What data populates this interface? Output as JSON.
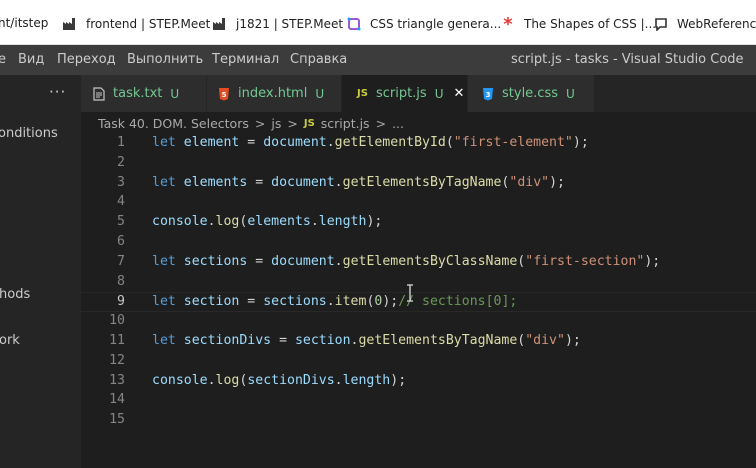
{
  "bookmarks": [
    {
      "label": "nt/itstep",
      "icon": "none"
    },
    {
      "label": "frontend | STEP.Meet",
      "icon": "factory-icon"
    },
    {
      "label": "j1821 | STEP.Meet",
      "icon": "factory-icon"
    },
    {
      "label": "CSS triangle genera...",
      "icon": "square-icon"
    },
    {
      "label": "The Shapes of CSS |...",
      "icon": "asterisk-icon"
    },
    {
      "label": "WebReference",
      "icon": "comment-icon"
    }
  ],
  "menu": [
    "е",
    "Вид",
    "Переход",
    "Выполнить",
    "Терминал",
    "Справка"
  ],
  "window_title": "script.js - tasks - Visual Studio Code",
  "sidebar": {
    "more": "···",
    "items": [
      "onditions",
      "hods",
      "ork"
    ]
  },
  "tabs": [
    {
      "label": "task.txt",
      "status": "U",
      "icon": "text-file-icon"
    },
    {
      "label": "index.html",
      "status": "U",
      "icon": "html5-icon"
    },
    {
      "label": "script.js",
      "status": "U",
      "icon": "js-icon",
      "active": true,
      "close": "✕"
    },
    {
      "label": "style.css",
      "status": "U",
      "icon": "css3-icon"
    }
  ],
  "breadcrumb": {
    "folder": "Task 40. DOM. Selectors",
    "sep1": ">",
    "sub": "js",
    "sep2": ">",
    "js_badge": "JS",
    "file": "script.js",
    "sep3": ">",
    "more": "..."
  },
  "editor": {
    "current_line": 9,
    "lines": [
      {
        "n": "1",
        "tokens": [
          [
            "kw",
            "let"
          ],
          [
            "punc",
            " "
          ],
          [
            "var",
            "element"
          ],
          [
            "punc",
            " = "
          ],
          [
            "var",
            "document"
          ],
          [
            "punc",
            "."
          ],
          [
            "fn",
            "getElementById"
          ],
          [
            "punc",
            "("
          ],
          [
            "str",
            "\"first-element\""
          ],
          [
            "punc",
            ");"
          ]
        ]
      },
      {
        "n": "2",
        "tokens": []
      },
      {
        "n": "3",
        "tokens": [
          [
            "kw",
            "let"
          ],
          [
            "punc",
            " "
          ],
          [
            "var",
            "elements"
          ],
          [
            "punc",
            " = "
          ],
          [
            "var",
            "document"
          ],
          [
            "punc",
            "."
          ],
          [
            "fn",
            "getElementsByTagName"
          ],
          [
            "punc",
            "("
          ],
          [
            "str",
            "\"div\""
          ],
          [
            "punc",
            ");"
          ]
        ]
      },
      {
        "n": "4",
        "tokens": []
      },
      {
        "n": "5",
        "tokens": [
          [
            "var",
            "console"
          ],
          [
            "punc",
            "."
          ],
          [
            "fn",
            "log"
          ],
          [
            "punc",
            "("
          ],
          [
            "var",
            "elements"
          ],
          [
            "punc",
            "."
          ],
          [
            "var",
            "length"
          ],
          [
            "punc",
            ");"
          ]
        ]
      },
      {
        "n": "6",
        "tokens": []
      },
      {
        "n": "7",
        "tokens": [
          [
            "kw",
            "let"
          ],
          [
            "punc",
            " "
          ],
          [
            "var",
            "sections"
          ],
          [
            "punc",
            " = "
          ],
          [
            "var",
            "document"
          ],
          [
            "punc",
            "."
          ],
          [
            "fn",
            "getElementsByClassName"
          ],
          [
            "punc",
            "("
          ],
          [
            "str",
            "\"first-section\""
          ],
          [
            "punc",
            ");"
          ]
        ]
      },
      {
        "n": "8",
        "tokens": []
      },
      {
        "n": "9",
        "tokens": [
          [
            "kw",
            "let"
          ],
          [
            "punc",
            " "
          ],
          [
            "var",
            "section"
          ],
          [
            "punc",
            " = "
          ],
          [
            "var",
            "sections"
          ],
          [
            "punc",
            "."
          ],
          [
            "fn",
            "item"
          ],
          [
            "punc",
            "("
          ],
          [
            "num",
            "0"
          ],
          [
            "punc",
            ");"
          ],
          [
            "cmt",
            "// sections[0];"
          ]
        ]
      },
      {
        "n": "10",
        "tokens": []
      },
      {
        "n": "11",
        "tokens": [
          [
            "kw",
            "let"
          ],
          [
            "punc",
            " "
          ],
          [
            "var",
            "sectionDivs"
          ],
          [
            "punc",
            " = "
          ],
          [
            "var",
            "section"
          ],
          [
            "punc",
            "."
          ],
          [
            "fn",
            "getElementsByTagName"
          ],
          [
            "punc",
            "("
          ],
          [
            "str",
            "\"div\""
          ],
          [
            "punc",
            ");"
          ]
        ]
      },
      {
        "n": "12",
        "tokens": []
      },
      {
        "n": "13",
        "tokens": [
          [
            "var",
            "console"
          ],
          [
            "punc",
            "."
          ],
          [
            "fn",
            "log"
          ],
          [
            "punc",
            "("
          ],
          [
            "var",
            "sectionDivs"
          ],
          [
            "punc",
            "."
          ],
          [
            "var",
            "length"
          ],
          [
            "punc",
            ");"
          ]
        ]
      },
      {
        "n": "14",
        "tokens": []
      },
      {
        "n": "15",
        "tokens": []
      }
    ]
  },
  "colors": {
    "keyword": "#569cd6",
    "variable": "#9cdcfe",
    "function": "#dcdcaa",
    "string": "#ce9178",
    "number": "#b5cea8",
    "comment": "#6a9955",
    "untracked": "#73c991"
  }
}
